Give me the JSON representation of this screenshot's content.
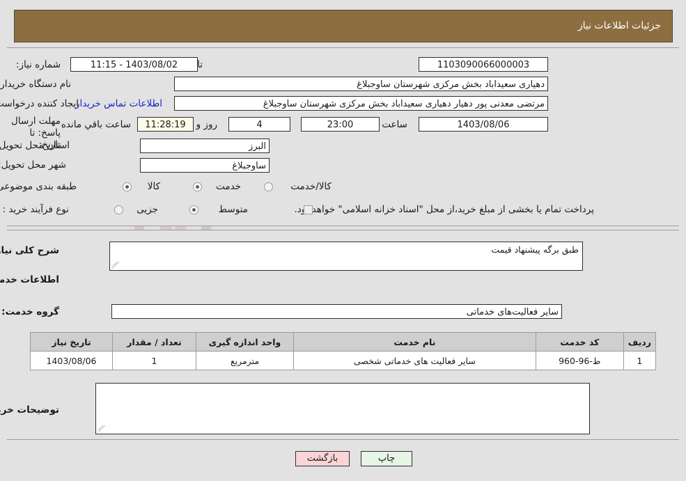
{
  "header": {
    "title": "جزئیات اطلاعات نیاز"
  },
  "form": {
    "need_number_label": "شماره نیاز:",
    "need_number_value": "1103090066000003",
    "announce_label": "تاریخ و ساعت اعلان عمومی:",
    "announce_value": "1403/08/02 - 11:15",
    "buyer_org_label": "نام دستگاه خریدار:",
    "buyer_org_value": "دهیاری سعیداباد بخش مرکزی شهرستان ساوجبلاغ",
    "creator_label": "ایجاد کننده درخواست:",
    "creator_value": "مرتضی معدنی پور دهیار دهیاری سعیداباد بخش مرکزی شهرستان ساوجبلاغ",
    "contact_link": "اطلاعات تماس خریدار",
    "deadline_label": "مهلت ارسال پاسخ: تا تاریخ:",
    "deadline_date": "1403/08/06",
    "hour_label": "ساعت",
    "hour_value": "23:00",
    "days_value": "4",
    "days_label": "روز و",
    "timer_value": "11:28:19",
    "remaining_label": "ساعت باقي مانده",
    "province_label": "استان محل تحویل:",
    "province_value": "البرز",
    "city_label": "شهر محل تحویل:",
    "city_value": "ساوجبلاغ",
    "category_label": "طبقه بندی موضوعی:",
    "category_options": [
      {
        "label": "کالا",
        "selected": false
      },
      {
        "label": "خدمت",
        "selected": true
      },
      {
        "label": "کالا/خدمت",
        "selected": false
      }
    ],
    "process_label": "نوع فرآیند خرید :",
    "process_options": [
      {
        "label": "جزیی",
        "selected": false
      },
      {
        "label": "متوسط",
        "selected": true
      }
    ],
    "treasury_note": "پرداخت تمام یا بخشی از مبلغ خرید،از محل \"اسناد خزانه اسلامی\" خواهد بود.",
    "summary_label": "شرح کلی نیاز:",
    "summary_value": "طبق برگه پیشنهاد قیمت",
    "services_heading": "اطلاعات خدمات مورد نیاز",
    "service_group_label": "گروه خدمت:",
    "service_group_value": "سایر فعالیت‌های خدماتی",
    "buyer_notes_label": "توضیحات خریدار:",
    "buyer_notes_value": ""
  },
  "table": {
    "columns": [
      "ردیف",
      "کد خدمت",
      "نام خدمت",
      "واحد اندازه گیری",
      "تعداد / مقدار",
      "تاریخ نیاز"
    ],
    "rows": [
      {
        "row": "1",
        "code": "ط-96-960",
        "name": "سایر فعالیت های خدماتی شخصی",
        "unit": "مترمربع",
        "quantity": "1",
        "date": "1403/08/06"
      }
    ]
  },
  "buttons": {
    "print": "چاپ",
    "back": "بازگشت"
  },
  "watermark": {
    "text": "AriaTender.net"
  },
  "colors": {
    "header_bg": "#8d6e41",
    "page_bg": "#e2e2e2",
    "link": "#1428c8",
    "print_btn": "#e6f5e6",
    "back_btn": "#fbd5d5",
    "table_header": "#cfcfcf",
    "timer_bg": "#fbfbe8"
  }
}
